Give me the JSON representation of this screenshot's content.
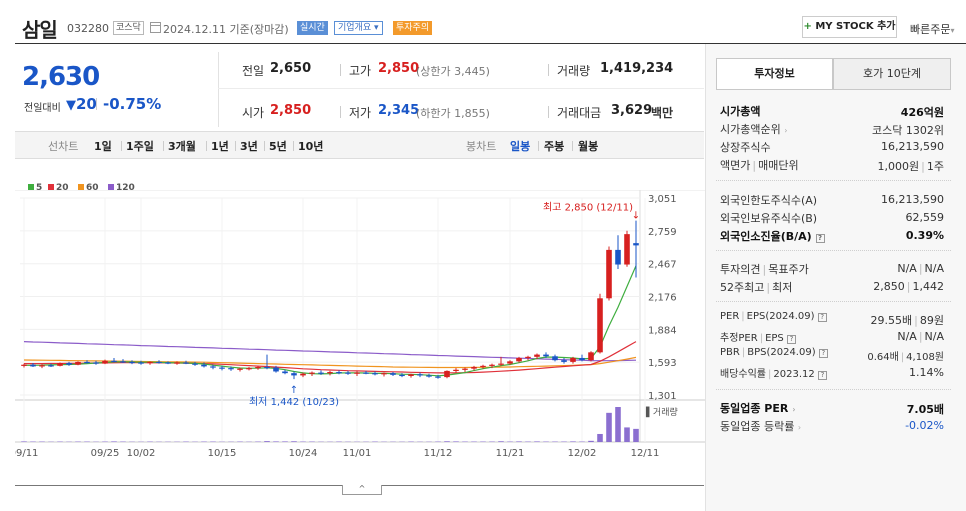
{
  "header": {
    "stock_name": "삼일",
    "stock_code": "032280",
    "market_badge": "코스닥",
    "date_text": "2024.12.11 기준(장마감)",
    "realtime_badge": "실시간",
    "company_overview": "기업개요",
    "company_overview_caret": "▾",
    "warning_badge": "투자주의",
    "mystock_plus": "+",
    "mystock_label": "MY STOCK 추가",
    "quick_order": "빠른주문",
    "quick_order_caret": "▾"
  },
  "price": {
    "current": "2,630",
    "compare_label": "전일대비",
    "direction_icon": "down-triangle-icon",
    "change_arrow": "▼",
    "change": "20",
    "rate": "-0.75%"
  },
  "quotes": {
    "prev_close_label": "전일",
    "prev_close": "2,650",
    "high_label": "고가",
    "high": "2,850",
    "upper_limit": "(상한가 3,445)",
    "volume_label": "거래량",
    "volume": "1,419,234",
    "open_label": "시가",
    "open": "2,850",
    "low_label": "저가",
    "low": "2,345",
    "lower_limit": "(하한가 1,855)",
    "amount_label": "거래대금",
    "amount": "3,629",
    "amount_unit": "백만"
  },
  "period_tabs": {
    "label": "선차트",
    "items": [
      "1일",
      "1주일",
      "3개월",
      "1년",
      "3년",
      "5년",
      "10년"
    ]
  },
  "candle_tabs": {
    "label": "봉차트",
    "items": [
      "일봉",
      "주봉",
      "월봉"
    ],
    "active": "일봉"
  },
  "colors": {
    "up": "#d7201f",
    "down": "#1a56c7",
    "ma5": "#3fae3f",
    "ma20": "#e0313a",
    "ma60": "#f0941f",
    "ma120": "#8b5cc9",
    "volume": "#8b6fd0"
  },
  "chart_data": {
    "type": "candlestick",
    "legend": [
      {
        "name": "5",
        "color": "#3fae3f"
      },
      {
        "name": "20",
        "color": "#e0313a"
      },
      {
        "name": "60",
        "color": "#f0941f"
      },
      {
        "name": "120",
        "color": "#8b5cc9"
      }
    ],
    "y_ticks": [
      3051,
      2759,
      2467,
      2176,
      1884,
      1593,
      1301
    ],
    "ylim": [
      1301,
      3051
    ],
    "x_tick_labels": [
      "09/11",
      "09/25",
      "10/02",
      "10/15",
      "10/24",
      "11/01",
      "11/12",
      "11/21",
      "12/02",
      "12/11"
    ],
    "x_tick_index": [
      0,
      9,
      13,
      22,
      31,
      37,
      46,
      54,
      62,
      69
    ],
    "high_annotation": "최고 2,850 (12/11)",
    "high_arrow": "↓",
    "low_annotation": "최저 1,442 (10/23)",
    "low_arrow": "↑",
    "volume_label": "거래량",
    "candles": [
      [
        1560,
        1580,
        1545,
        1570
      ],
      [
        1570,
        1585,
        1550,
        1555
      ],
      [
        1555,
        1575,
        1540,
        1565
      ],
      [
        1565,
        1580,
        1550,
        1560
      ],
      [
        1560,
        1590,
        1555,
        1585
      ],
      [
        1585,
        1595,
        1560,
        1570
      ],
      [
        1570,
        1600,
        1565,
        1595
      ],
      [
        1595,
        1610,
        1580,
        1590
      ],
      [
        1590,
        1605,
        1570,
        1580
      ],
      [
        1580,
        1615,
        1575,
        1605
      ],
      [
        1605,
        1630,
        1590,
        1600
      ],
      [
        1600,
        1620,
        1585,
        1595
      ],
      [
        1595,
        1610,
        1575,
        1590
      ],
      [
        1590,
        1605,
        1570,
        1585
      ],
      [
        1585,
        1600,
        1570,
        1595
      ],
      [
        1595,
        1610,
        1580,
        1590
      ],
      [
        1590,
        1600,
        1575,
        1585
      ],
      [
        1585,
        1600,
        1570,
        1590
      ],
      [
        1590,
        1605,
        1575,
        1580
      ],
      [
        1580,
        1595,
        1560,
        1570
      ],
      [
        1570,
        1590,
        1545,
        1555
      ],
      [
        1555,
        1570,
        1530,
        1545
      ],
      [
        1545,
        1560,
        1520,
        1540
      ],
      [
        1540,
        1555,
        1515,
        1530
      ],
      [
        1530,
        1545,
        1510,
        1535
      ],
      [
        1535,
        1550,
        1520,
        1540
      ],
      [
        1540,
        1560,
        1525,
        1550
      ],
      [
        1550,
        1660,
        1530,
        1545
      ],
      [
        1545,
        1560,
        1500,
        1510
      ],
      [
        1510,
        1525,
        1485,
        1495
      ],
      [
        1495,
        1510,
        1442,
        1475
      ],
      [
        1475,
        1500,
        1460,
        1490
      ],
      [
        1490,
        1510,
        1470,
        1500
      ],
      [
        1500,
        1520,
        1480,
        1495
      ],
      [
        1495,
        1515,
        1475,
        1505
      ],
      [
        1505,
        1520,
        1485,
        1500
      ],
      [
        1500,
        1515,
        1480,
        1490
      ],
      [
        1490,
        1510,
        1470,
        1500
      ],
      [
        1500,
        1515,
        1485,
        1495
      ],
      [
        1495,
        1510,
        1475,
        1485
      ],
      [
        1485,
        1500,
        1465,
        1495
      ],
      [
        1495,
        1505,
        1470,
        1480
      ],
      [
        1480,
        1495,
        1460,
        1470
      ],
      [
        1470,
        1490,
        1455,
        1485
      ],
      [
        1485,
        1500,
        1460,
        1475
      ],
      [
        1475,
        1490,
        1455,
        1465
      ],
      [
        1465,
        1480,
        1445,
        1460
      ],
      [
        1460,
        1520,
        1450,
        1515
      ],
      [
        1515,
        1540,
        1500,
        1525
      ],
      [
        1525,
        1545,
        1505,
        1535
      ],
      [
        1535,
        1560,
        1520,
        1550
      ],
      [
        1550,
        1570,
        1535,
        1560
      ],
      [
        1560,
        1580,
        1540,
        1570
      ],
      [
        1570,
        1640,
        1560,
        1580
      ],
      [
        1580,
        1610,
        1570,
        1600
      ],
      [
        1600,
        1640,
        1590,
        1630
      ],
      [
        1630,
        1650,
        1610,
        1640
      ],
      [
        1640,
        1670,
        1620,
        1660
      ],
      [
        1660,
        1680,
        1630,
        1645
      ],
      [
        1645,
        1660,
        1600,
        1610
      ],
      [
        1610,
        1630,
        1580,
        1595
      ],
      [
        1595,
        1640,
        1580,
        1630
      ],
      [
        1630,
        1660,
        1600,
        1610
      ],
      [
        1610,
        1690,
        1600,
        1680
      ],
      [
        1680,
        2200,
        1670,
        2160
      ],
      [
        2160,
        2620,
        2140,
        2590
      ],
      [
        2590,
        2720,
        2420,
        2460
      ],
      [
        2460,
        2760,
        2440,
        2730
      ],
      [
        2650,
        2850,
        2345,
        2630
      ]
    ],
    "volumes": [
      4,
      3,
      3,
      2,
      3,
      2,
      3,
      3,
      2,
      3,
      4,
      3,
      2,
      2,
      3,
      2,
      2,
      2,
      3,
      2,
      3,
      3,
      2,
      2,
      3,
      2,
      3,
      6,
      4,
      4,
      5,
      3,
      3,
      2,
      2,
      3,
      2,
      2,
      2,
      3,
      2,
      2,
      2,
      3,
      2,
      2,
      3,
      5,
      4,
      3,
      3,
      3,
      3,
      5,
      3,
      4,
      3,
      4,
      3,
      3,
      3,
      4,
      3,
      8,
      55,
      200,
      240,
      100,
      90
    ],
    "ma5": [
      1565,
      1565,
      1566,
      1568,
      1570,
      1572,
      1575,
      1580,
      1585,
      1590,
      1595,
      1596,
      1594,
      1592,
      1592,
      1591,
      1589,
      1586,
      1585,
      1582,
      1576,
      1566,
      1558,
      1548,
      1541,
      1538,
      1540,
      1543,
      1537,
      1526,
      1510,
      1497,
      1490,
      1488,
      1491,
      1496,
      1498,
      1497,
      1496,
      1494,
      1493,
      1490,
      1486,
      1484,
      1481,
      1477,
      1472,
      1478,
      1488,
      1500,
      1518,
      1535,
      1548,
      1562,
      1572,
      1588,
      1605,
      1625,
      1638,
      1638,
      1634,
      1630,
      1622,
      1626,
      1730,
      1915,
      2080,
      2265,
      2450
    ],
    "ma20": [
      1580,
      1580,
      1580,
      1581,
      1581,
      1582,
      1583,
      1584,
      1585,
      1586,
      1587,
      1588,
      1588,
      1588,
      1587,
      1587,
      1586,
      1585,
      1584,
      1582,
      1580,
      1577,
      1574,
      1570,
      1566,
      1562,
      1558,
      1554,
      1549,
      1544,
      1539,
      1534,
      1530,
      1526,
      1523,
      1520,
      1517,
      1515,
      1513,
      1511,
      1509,
      1507,
      1505,
      1503,
      1501,
      1499,
      1497,
      1497,
      1498,
      1499,
      1501,
      1504,
      1508,
      1512,
      1517,
      1522,
      1528,
      1535,
      1542,
      1548,
      1554,
      1560,
      1566,
      1572,
      1600,
      1640,
      1685,
      1730,
      1775
    ],
    "ma60": [
      1612,
      1611,
      1610,
      1609,
      1608,
      1607,
      1606,
      1605,
      1604,
      1603,
      1602,
      1601,
      1600,
      1599,
      1598,
      1597,
      1596,
      1595,
      1594,
      1593,
      1592,
      1590,
      1588,
      1586,
      1584,
      1582,
      1580,
      1578,
      1576,
      1574,
      1572,
      1570,
      1568,
      1566,
      1564,
      1562,
      1560,
      1558,
      1556,
      1554,
      1552,
      1550,
      1549,
      1548,
      1547,
      1546,
      1545,
      1545,
      1545,
      1545,
      1546,
      1547,
      1548,
      1549,
      1550,
      1552,
      1554,
      1556,
      1558,
      1560,
      1562,
      1565,
      1568,
      1571,
      1580,
      1592,
      1606,
      1620,
      1635
    ],
    "ma120": [
      1775,
      1772,
      1770,
      1767,
      1764,
      1762,
      1759,
      1756,
      1754,
      1751,
      1748,
      1746,
      1743,
      1740,
      1738,
      1735,
      1732,
      1730,
      1727,
      1724,
      1722,
      1719,
      1716,
      1714,
      1711,
      1708,
      1706,
      1703,
      1700,
      1698,
      1695,
      1692,
      1690,
      1687,
      1684,
      1682,
      1679,
      1676,
      1674,
      1671,
      1668,
      1666,
      1663,
      1660,
      1658,
      1655,
      1652,
      1650,
      1647,
      1644,
      1642,
      1639,
      1636,
      1634,
      1631,
      1628,
      1626,
      1623,
      1620,
      1618,
      1615,
      1612,
      1610,
      1607,
      1606,
      1606,
      1607,
      1608,
      1610
    ]
  },
  "right_panel": {
    "tabs": [
      "투자정보",
      "호가 10단계"
    ],
    "market_cap_label": "시가총액",
    "market_cap": "426억원",
    "cap_rank_label": "시가총액순위",
    "cap_rank": "코스닥 1302위",
    "shares_label": "상장주식수",
    "shares": "16,213,590",
    "par_label": "액면가",
    "trade_unit_label": "매매단위",
    "par": "1,000원",
    "trade_unit": "1주",
    "foreign_limit_label": "외국인한도주식수(A)",
    "foreign_limit": "16,213,590",
    "foreign_hold_label": "외국인보유주식수(B)",
    "foreign_hold": "62,559",
    "foreign_ratio_label": "외국인소진율(B/A)",
    "foreign_ratio": "0.39%",
    "opinion_label": "투자의견",
    "target_label": "목표주가",
    "opinion": "N/A",
    "target": "N/A",
    "w52_high_label": "52주최고",
    "w52_low_label": "최저",
    "w52_high": "2,850",
    "w52_low": "1,442",
    "per_label": "PER",
    "eps_label": "EPS(2024.09)",
    "per": "29.55배",
    "eps": "89원",
    "est_per_label": "추정PER",
    "est_eps_label": "EPS",
    "est_per": "N/A",
    "est_eps": "N/A",
    "pbr_label": "PBR",
    "bps_label": "BPS(2024.09)",
    "pbr": "0.64배",
    "bps": "4,108원",
    "div_label": "배당수익률",
    "div_year": "2023.12",
    "div": "1.14%",
    "sector_per_label": "동일업종 PER",
    "sector_per": "7.05배",
    "sector_rate_label": "동일업종 등락률",
    "sector_rate": "-0.02%"
  }
}
